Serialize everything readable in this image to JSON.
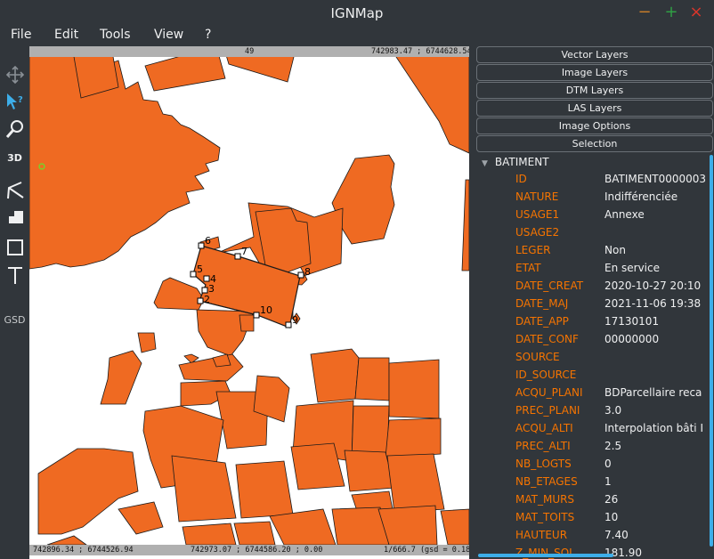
{
  "window": {
    "title": "IGNMap",
    "minimize": "−",
    "maximize": "+",
    "close": "×"
  },
  "menu": {
    "file": "File",
    "edit": "Edit",
    "tools": "Tools",
    "view": "View",
    "help": "?"
  },
  "toolbar": {
    "threed_label": "3D",
    "gsd_label": "GSD"
  },
  "map": {
    "top_center": "49",
    "top_right": "742983.47 ; 6744628.54",
    "bottom_left": "742896.34 ; 6744526.94",
    "bottom_center": "742973.07 ; 6744586.20 ; 0.00",
    "bottom_right": "1/666.7 (gsd = 0.18)",
    "vertex_labels": [
      "2",
      "3",
      "4",
      "5",
      "6",
      "7",
      "8",
      "9",
      "10"
    ],
    "colors": {
      "building_fill": "#ef6a22",
      "building_stroke": "#1a1a1a",
      "background": "#ffffff"
    }
  },
  "panel": {
    "buttons": [
      "Vector Layers",
      "Image Layers",
      "DTM Layers",
      "LAS Layers",
      "Image Options",
      "Selection"
    ],
    "layer_name": "BATIMENT",
    "attributes": [
      {
        "key": "ID",
        "value": "BATIMENT0000003"
      },
      {
        "key": "NATURE",
        "value": "Indifférenciée"
      },
      {
        "key": "USAGE1",
        "value": "Annexe"
      },
      {
        "key": "USAGE2",
        "value": ""
      },
      {
        "key": "LEGER",
        "value": "Non"
      },
      {
        "key": "ETAT",
        "value": "En service"
      },
      {
        "key": "DATE_CREAT",
        "value": "2020-10-27 20:10"
      },
      {
        "key": "DATE_MAJ",
        "value": "2021-11-06 19:38"
      },
      {
        "key": "DATE_APP",
        "value": "17130101"
      },
      {
        "key": "DATE_CONF",
        "value": "00000000"
      },
      {
        "key": "SOURCE",
        "value": ""
      },
      {
        "key": "ID_SOURCE",
        "value": ""
      },
      {
        "key": "ACQU_PLANI",
        "value": "BDParcellaire reca"
      },
      {
        "key": "PREC_PLANI",
        "value": "3.0"
      },
      {
        "key": "ACQU_ALTI",
        "value": "Interpolation bâti I"
      },
      {
        "key": "PREC_ALTI",
        "value": "2.5"
      },
      {
        "key": "NB_LOGTS",
        "value": "0"
      },
      {
        "key": "NB_ETAGES",
        "value": "1"
      },
      {
        "key": "MAT_MURS",
        "value": "26"
      },
      {
        "key": "MAT_TOITS",
        "value": "10"
      },
      {
        "key": "HAUTEUR",
        "value": "7.40"
      },
      {
        "key": "Z_MIN_SOL",
        "value": "181.90"
      }
    ],
    "colors": {
      "key": "#f67400",
      "accent": "#3daee9"
    }
  }
}
